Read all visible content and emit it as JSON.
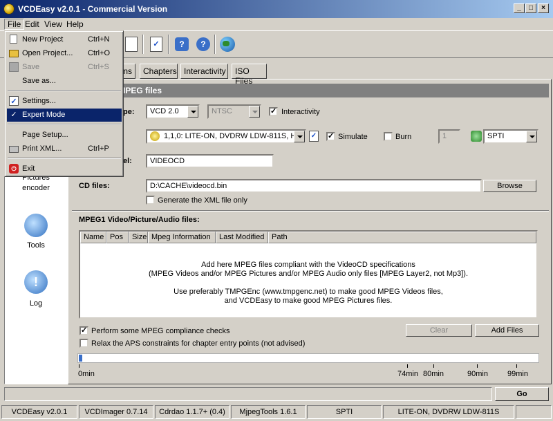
{
  "window": {
    "title": "VCDEasy v2.0.1 - Commercial Version"
  },
  "menubar": {
    "file": "File",
    "edit": "Edit",
    "view": "View",
    "help": "Help"
  },
  "file_menu": {
    "new_project": "New Project",
    "new_project_key": "Ctrl+N",
    "open_project": "Open Project...",
    "open_project_key": "Ctrl+O",
    "save": "Save",
    "save_key": "Ctrl+S",
    "save_as": "Save as...",
    "settings": "Settings...",
    "expert_mode": "Expert Mode",
    "page_setup": "Page Setup...",
    "print_xml": "Print XML...",
    "print_xml_key": "Ctrl+P",
    "exit": "Exit"
  },
  "left_panel": {
    "pictures_1": "Pictures",
    "pictures_2": "encoder",
    "tools": "Tools",
    "log": "Log"
  },
  "tabs": {
    "options": "ons",
    "chapters": "Chapters",
    "interactivity": "Interactivity",
    "iso_files": "ISO Files"
  },
  "header": {
    "title": "eoCD and MPEG files"
  },
  "form": {
    "type_label": "pe:",
    "vcd_type": "VCD 2.0",
    "tv_standard": "NTSC",
    "interactivity_label": "Interactivity",
    "drive": "1,1,0: LITE-ON, DVDRW LDW-811S, HS",
    "simulate_label": "Simulate",
    "burn_label": "Burn",
    "copies": "1",
    "interface": "SPTI",
    "volume_label_label": "el:",
    "volume_label": "VIDEOCD",
    "cd_files_label": "CD files:",
    "cd_file_path": "D:\\CACHE\\videocd.bin",
    "browse_label": "Browse",
    "xml_only_label": "Generate the XML file only"
  },
  "files_section": {
    "title": "MPEG1 Video/Picture/Audio files:",
    "columns": [
      "Name",
      "Pos",
      "Size",
      "Mpeg Information",
      "Last Modified",
      "Path"
    ],
    "hint_1": "Add here MPEG files compliant with the VideoCD specifications",
    "hint_2": "(MPEG Videos and/or MPEG Pictures and/or MPEG Audio only files [MPEG Layer2, not Mp3]).",
    "hint_3": "Use preferably TMPGEnc (www.tmpgenc.net) to make good MPEG Videos files,",
    "hint_4": "and VCDEasy to make good MPEG Pictures files.",
    "compliance_label": "Perform some MPEG compliance checks",
    "aps_label": "Relax the APS constraints for chapter entry points (not advised)",
    "clear_label": "Clear",
    "add_files_label": "Add Files"
  },
  "timeline": {
    "t0": "0min",
    "t74": "74min",
    "t80": "80min",
    "t90": "90min",
    "t99": "99min"
  },
  "go_label": "Go",
  "statusbar": {
    "vcdeasy": "VCDEasy v2.0.1",
    "vcdimager": "VCDImager 0.7.14",
    "cdrdao": "Cdrdao 1.1.7+ (0.4)",
    "mjpegtools": "MjpegTools 1.6.1",
    "interface": "SPTI",
    "drive": "LITE-ON, DVDRW LDW-811S"
  },
  "icons": {
    "app": "vcd-disc-icon",
    "save": "save-icon",
    "check": "checklist-icon",
    "help": "help-icon",
    "web": "globe-icon",
    "tools": "tools-icon",
    "log": "info-icon"
  }
}
